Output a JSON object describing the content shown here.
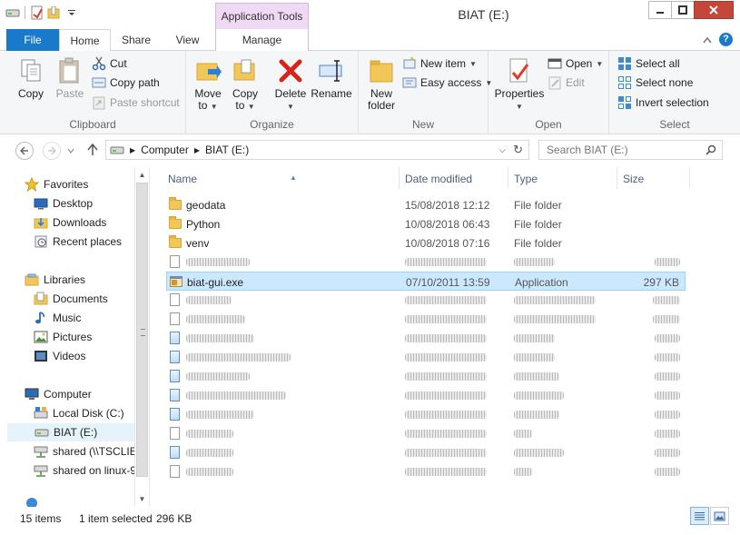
{
  "window": {
    "title": "BIAT (E:)",
    "context_tab": "Application Tools"
  },
  "tabs": {
    "file": "File",
    "home": "Home",
    "share": "Share",
    "view": "View",
    "manage": "Manage"
  },
  "ribbon": {
    "clipboard": {
      "label": "Clipboard",
      "copy": "Copy",
      "paste": "Paste",
      "cut": "Cut",
      "copy_path": "Copy path",
      "paste_shortcut": "Paste shortcut"
    },
    "organize": {
      "label": "Organize",
      "move_to_1": "Move",
      "move_to_2": "to",
      "copy_to_1": "Copy",
      "copy_to_2": "to",
      "delete": "Delete",
      "rename": "Rename"
    },
    "new": {
      "label": "New",
      "new_folder_1": "New",
      "new_folder_2": "folder",
      "new_item": "New item",
      "easy_access": "Easy access"
    },
    "open": {
      "label": "Open",
      "properties": "Properties",
      "open": "Open",
      "edit": "Edit"
    },
    "select": {
      "label": "Select",
      "select_all": "Select all",
      "select_none": "Select none",
      "invert_selection": "Invert selection"
    }
  },
  "address": {
    "computer": "Computer",
    "drive": "BIAT (E:)",
    "search_placeholder": "Search BIAT (E:)"
  },
  "nav": {
    "favorites": "Favorites",
    "desktop": "Desktop",
    "downloads": "Downloads",
    "recent_places": "Recent places",
    "libraries": "Libraries",
    "documents": "Documents",
    "music": "Music",
    "pictures": "Pictures",
    "videos": "Videos",
    "computer": "Computer",
    "local_disk": "Local Disk (C:)",
    "biat": "BIAT (E:)",
    "shared_ts": "shared (\\\\TSCLIE",
    "shared_linux": "shared on linux-9"
  },
  "columns": {
    "name": "Name",
    "date_modified": "Date modified",
    "type": "Type",
    "size": "Size"
  },
  "files": [
    {
      "name": "geodata",
      "date": "15/08/2018 12:12",
      "type": "File folder",
      "size": ""
    },
    {
      "name": "Python",
      "date": "10/08/2018 06:43",
      "type": "File folder",
      "size": ""
    },
    {
      "name": "venv",
      "date": "10/08/2018 07:16",
      "type": "File folder",
      "size": ""
    },
    {
      "name": "biat-gui.exe",
      "date": "07/10/2011 13:59",
      "type": "Application",
      "size": "297 KB"
    }
  ],
  "status": {
    "items": "15 items",
    "selected": "1 item selected",
    "size": "296 KB"
  }
}
